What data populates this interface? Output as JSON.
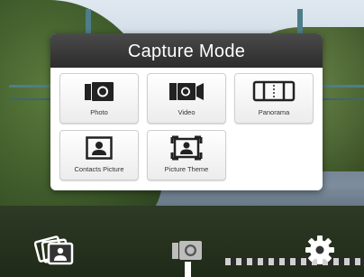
{
  "popup": {
    "title": "Capture Mode",
    "modes": [
      {
        "label": "Photo",
        "icon": "camera-icon"
      },
      {
        "label": "Video",
        "icon": "video-camera-icon"
      },
      {
        "label": "Panorama",
        "icon": "panorama-icon"
      },
      {
        "label": "Contacts Picture",
        "icon": "contact-card-icon"
      },
      {
        "label": "Picture Theme",
        "icon": "picture-theme-icon"
      }
    ]
  },
  "bottom_bar": {
    "album_icon": "album-icon",
    "capture_icon": "camera-icon",
    "settings_icon": "gear-icon"
  },
  "colors": {
    "header_bg": "#333333",
    "tile_bg": "#f2f2f2",
    "icon": "#222222"
  }
}
